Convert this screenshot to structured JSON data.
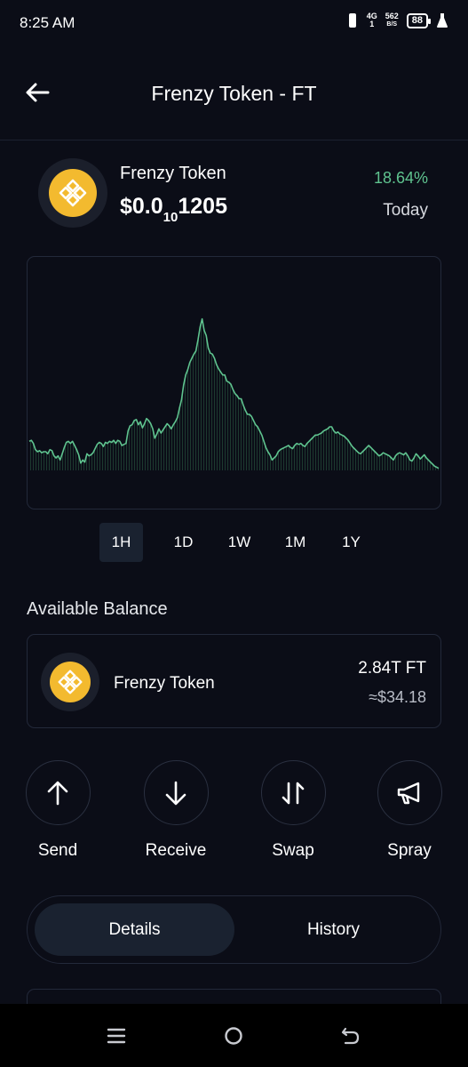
{
  "status_bar": {
    "time": "8:25 AM",
    "network": "4G",
    "network_sub": "1",
    "speed_value": "562",
    "speed_unit": "B/S",
    "battery": "88"
  },
  "header": {
    "title": "Frenzy Token - FT",
    "back_icon": "arrow-left-icon"
  },
  "token": {
    "name": "Frenzy Token",
    "price_prefix": "$0.0",
    "price_zero_count": "10",
    "price_suffix": "1205",
    "change_percent": "18.64%",
    "change_label": "Today",
    "logo_icon": "bnb-coin-icon",
    "brand_color": "#f3ba2f",
    "change_color": "#5fc38f"
  },
  "chart_data": {
    "type": "line",
    "title": "",
    "xlabel": "",
    "ylabel": "",
    "grid": false,
    "legend": "none",
    "line_color": "#5fc38f",
    "x": [
      0,
      1,
      2,
      3,
      4,
      5,
      6,
      7,
      8,
      9,
      10,
      11,
      12,
      13,
      14,
      15,
      16,
      17,
      18,
      19,
      20,
      21,
      22,
      23,
      24,
      25,
      26,
      27,
      28,
      29,
      30,
      31,
      32,
      33,
      34,
      35,
      36,
      37,
      38,
      39,
      40,
      41,
      42,
      43,
      44,
      45,
      46,
      47,
      48,
      49,
      50,
      51,
      52,
      53,
      54,
      55,
      56,
      57,
      58,
      59,
      60,
      61,
      62,
      63,
      64,
      65,
      66,
      67,
      68,
      69,
      70,
      71,
      72,
      73,
      74,
      75,
      76,
      77,
      78,
      79,
      80,
      81,
      82,
      83,
      84,
      85,
      86,
      87,
      88,
      89,
      90,
      91,
      92,
      93,
      94,
      95,
      96,
      97,
      98,
      99,
      100,
      101,
      102,
      103,
      104,
      105,
      106,
      107,
      108,
      109,
      110,
      111,
      112,
      113,
      114,
      115,
      116,
      117,
      118,
      119,
      120,
      121,
      122,
      123,
      124,
      125,
      126,
      127,
      128,
      129,
      130,
      131,
      132,
      133,
      134,
      135,
      136,
      137,
      138,
      139,
      140,
      141,
      142,
      143,
      144,
      145,
      146,
      147,
      148,
      149,
      150,
      151,
      152,
      153,
      154,
      155,
      156,
      157,
      158,
      159,
      160,
      161,
      162,
      163,
      164,
      165,
      166,
      167,
      168,
      169,
      170,
      171,
      172,
      173,
      174,
      175,
      176,
      177,
      178,
      179,
      180,
      181,
      182,
      183,
      184,
      185,
      186,
      187,
      188,
      189,
      190,
      191,
      192,
      193,
      194,
      195,
      196,
      197,
      198,
      199
    ],
    "y": [
      28,
      29,
      26,
      20,
      18,
      19,
      17,
      18,
      18,
      16,
      20,
      19,
      14,
      12,
      14,
      10,
      16,
      22,
      27,
      28,
      26,
      28,
      24,
      20,
      15,
      7,
      10,
      8,
      16,
      14,
      15,
      17,
      21,
      25,
      27,
      26,
      23,
      27,
      26,
      28,
      27,
      29,
      26,
      29,
      28,
      24,
      25,
      26,
      38,
      43,
      44,
      48,
      49,
      44,
      47,
      41,
      45,
      50,
      48,
      45,
      40,
      31,
      35,
      40,
      36,
      39,
      42,
      45,
      43,
      40,
      44,
      47,
      51,
      60,
      68,
      82,
      92,
      97,
      104,
      108,
      112,
      115,
      126,
      138,
      146,
      135,
      130,
      118,
      113,
      112,
      108,
      102,
      98,
      95,
      92,
      92,
      86,
      85,
      83,
      78,
      74,
      72,
      69,
      69,
      63,
      58,
      54,
      54,
      52,
      48,
      44,
      42,
      38,
      34,
      28,
      22,
      18,
      15,
      10,
      12,
      14,
      18,
      20,
      21,
      22,
      23,
      24,
      22,
      21,
      24,
      26,
      25,
      26,
      24,
      23,
      26,
      28,
      30,
      32,
      34,
      34,
      35,
      36,
      38,
      39,
      40,
      42,
      42,
      38,
      36,
      37,
      35,
      34,
      33,
      31,
      29,
      26,
      23,
      21,
      19,
      17,
      16,
      18,
      20,
      22,
      24,
      22,
      20,
      18,
      16,
      14,
      15,
      17,
      16,
      15,
      14,
      12,
      10,
      14,
      16,
      17,
      16,
      15,
      17,
      14,
      10,
      9,
      12,
      16,
      14,
      11,
      13,
      15,
      12,
      10,
      8,
      6,
      4,
      3,
      2
    ],
    "ylim": [
      0,
      180
    ]
  },
  "ranges": [
    "1H",
    "1D",
    "1W",
    "1M",
    "1Y"
  ],
  "active_range": "1H",
  "balance": {
    "heading": "Available Balance",
    "token_name": "Frenzy Token",
    "amount": "2.84T FT",
    "usd_value": "≈$34.18"
  },
  "actions": [
    {
      "label": "Send",
      "icon": "arrow-up-icon"
    },
    {
      "label": "Receive",
      "icon": "arrow-down-icon"
    },
    {
      "label": "Swap",
      "icon": "swap-arrows-icon"
    },
    {
      "label": "Spray",
      "icon": "megaphone-icon"
    }
  ],
  "segment": {
    "details_label": "Details",
    "history_label": "History"
  },
  "nav": {
    "menu_icon": "menu-lines-icon",
    "home_icon": "home-circle-icon",
    "back_icon": "back-arrow-icon"
  },
  "colors": {
    "background": "#0b0d17",
    "card_border": "#23293a",
    "active_tab": "#1a2230"
  }
}
